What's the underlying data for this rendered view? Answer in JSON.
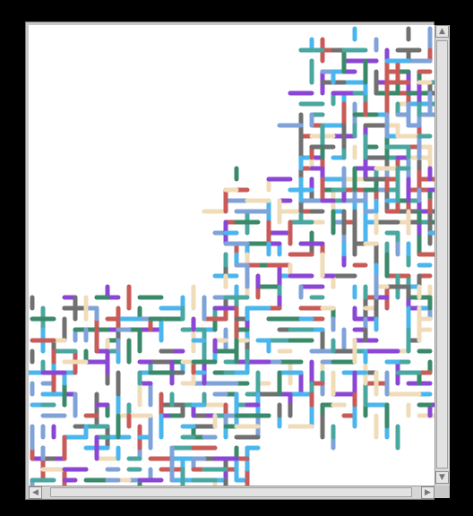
{
  "window": {
    "title": ""
  },
  "canvas": {
    "description_colors": [
      "#c85b57",
      "#8b46d6",
      "#4bb6ee",
      "#3a8a6a",
      "#7fa3d8",
      "#f0dcb8",
      "#707070",
      "#4aa7a0"
    ]
  },
  "scrollbars": {
    "vertical": {
      "up_icon": "arrow-up-icon",
      "down_icon": "arrow-down-icon"
    },
    "horizontal": {
      "left_icon": "arrow-left-icon",
      "right_icon": "arrow-right-icon"
    }
  },
  "colors": {
    "background": "#000000",
    "canvas": "#ffffff",
    "scrollbar": "#d6d6d6"
  }
}
